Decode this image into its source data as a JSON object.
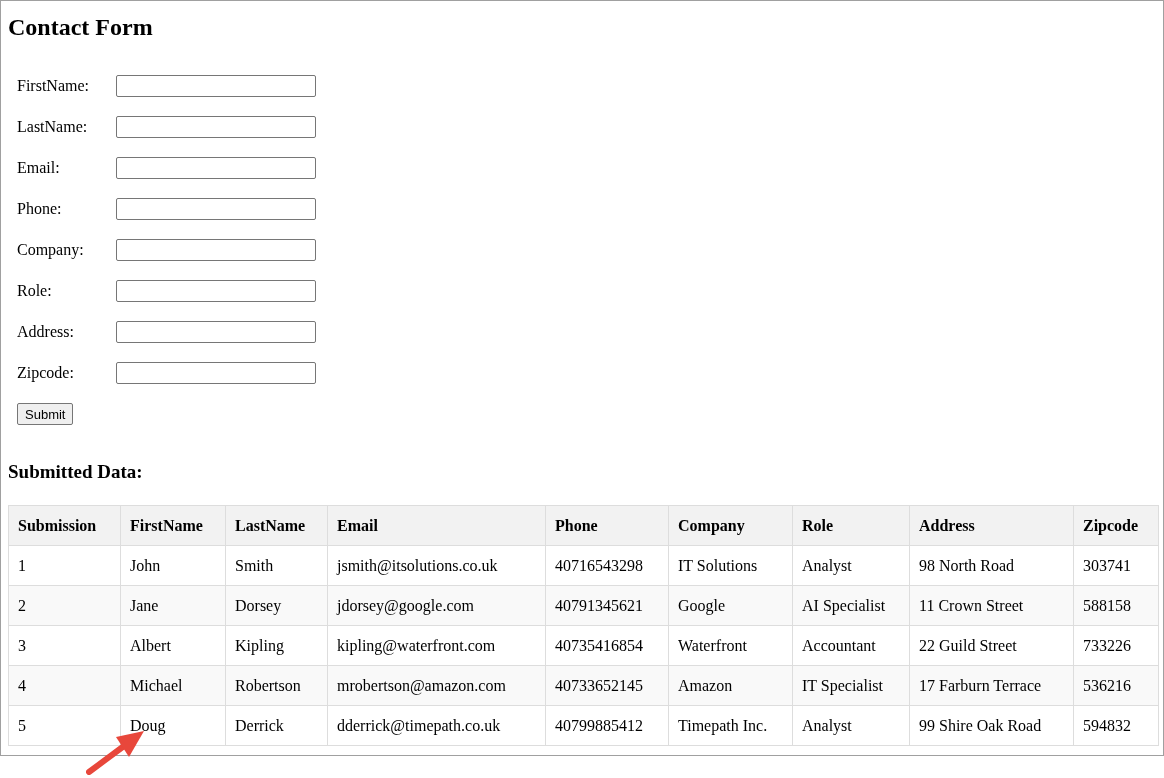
{
  "title": "Contact Form",
  "form": {
    "fields": [
      {
        "label": "FirstName:"
      },
      {
        "label": "LastName:"
      },
      {
        "label": "Email:"
      },
      {
        "label": "Phone:"
      },
      {
        "label": "Company:"
      },
      {
        "label": "Role:"
      },
      {
        "label": "Address:"
      },
      {
        "label": "Zipcode:"
      }
    ],
    "submit": "Submit"
  },
  "results_heading": "Submitted Data:",
  "table": {
    "columns": [
      "Submission",
      "FirstName",
      "LastName",
      "Email",
      "Phone",
      "Company",
      "Role",
      "Address",
      "Zipcode"
    ],
    "rows": [
      [
        "1",
        "John",
        "Smith",
        "jsmith@itsolutions.co.uk",
        "40716543298",
        "IT Solutions",
        "Analyst",
        "98 North Road",
        "303741"
      ],
      [
        "2",
        "Jane",
        "Dorsey",
        "jdorsey@google.com",
        "40791345621",
        "Google",
        "AI Specialist",
        "11 Crown Street",
        "588158"
      ],
      [
        "3",
        "Albert",
        "Kipling",
        "kipling@waterfront.com",
        "40735416854",
        "Waterfront",
        "Accountant",
        "22 Guild Street",
        "733226"
      ],
      [
        "4",
        "Michael",
        "Robertson",
        "mrobertson@amazon.com",
        "40733652145",
        "Amazon",
        "IT Specialist",
        "17 Farburn Terrace",
        "536216"
      ],
      [
        "5",
        "Doug",
        "Derrick",
        "dderrick@timepath.co.uk",
        "40799885412",
        "Timepath Inc.",
        "Analyst",
        "99 Shire Oak Road",
        "594832"
      ]
    ]
  }
}
